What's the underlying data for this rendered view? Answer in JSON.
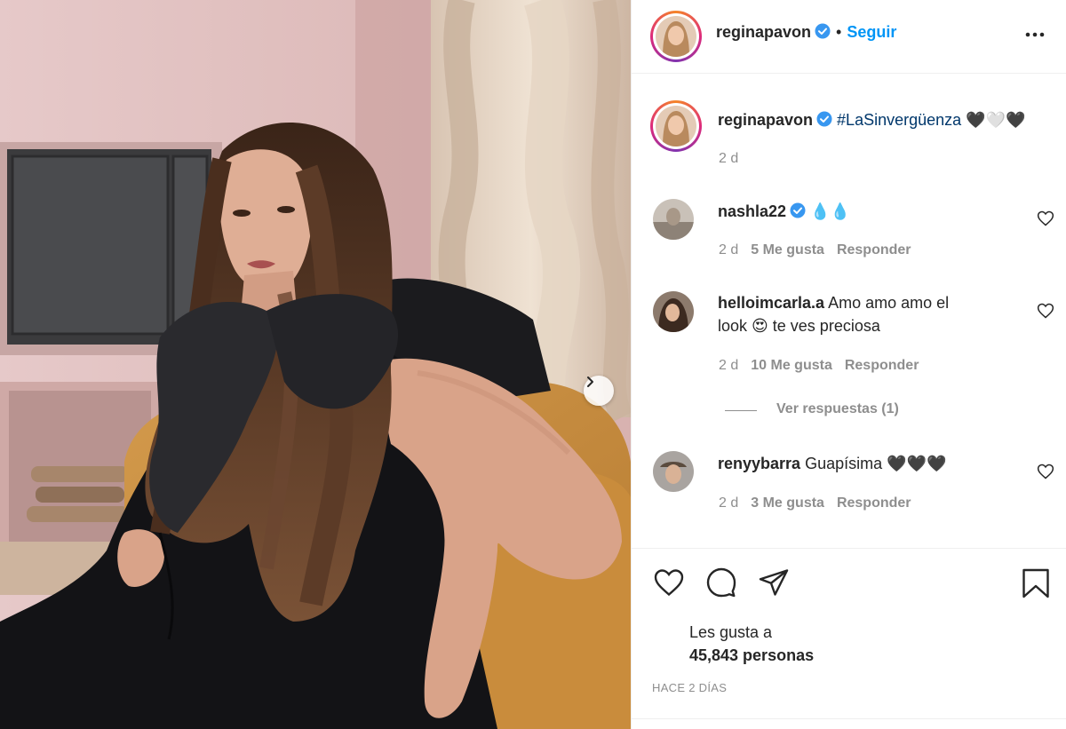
{
  "post": {
    "author": "reginapavon",
    "follow_label": "Seguir",
    "dot": "•",
    "caption_hashtag": "#LaSinvergüenza",
    "caption_suffix": "🖤🤍🖤",
    "caption_time": "2 d"
  },
  "comments": [
    {
      "user": "nashla22",
      "verified": true,
      "text": "💧💧",
      "time": "2 d",
      "likes": "5 Me gusta",
      "reply": "Responder"
    },
    {
      "user": "helloimcarla.a",
      "verified": false,
      "text": "Amo amo amo el",
      "text2": "look 😍 te ves preciosa",
      "time": "2 d",
      "likes": "10 Me gusta",
      "reply": "Responder",
      "view_replies": "Ver respuestas (1)"
    },
    {
      "user": "renyybarra",
      "verified": false,
      "text": "Guapísima 🖤🖤🖤",
      "time": "2 d",
      "likes": "3 Me gusta",
      "reply": "Responder"
    }
  ],
  "actions": {
    "likes_label": "Les gusta a",
    "likes_count": "45,843 personas",
    "date_ago": "HACE 2 DÍAS"
  },
  "colors": {
    "accent": "#0095f6",
    "text": "#262626",
    "muted": "#8e8e8e",
    "border": "#efefef"
  },
  "icons": [
    "more-icon",
    "verified-icon",
    "heart-icon",
    "comment-icon",
    "share-icon",
    "bookmark-icon",
    "chevron-right-icon"
  ]
}
